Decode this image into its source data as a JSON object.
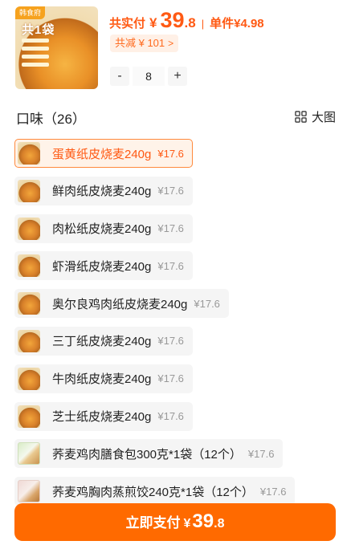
{
  "product": {
    "thumb_badge": "韩食府",
    "thumb_title": "共1袋",
    "total_label": "共实付",
    "currency": "¥",
    "total_int": "39",
    "total_dec": ".8",
    "separator": "|",
    "unit_price": "单件¥4.98",
    "discount": "共减 ¥ 101",
    "discount_chevron": ">",
    "quantity": "8",
    "minus": "-",
    "plus": "+"
  },
  "flavors": {
    "title": "口味（26）",
    "view_toggle_label": "大图",
    "items": [
      {
        "name": "蛋黄纸皮烧麦240g",
        "price": "¥17.6"
      },
      {
        "name": "鲜肉纸皮烧麦240g",
        "price": "¥17.6"
      },
      {
        "name": "肉松纸皮烧麦240g",
        "price": "¥17.6"
      },
      {
        "name": "虾滑纸皮烧麦240g",
        "price": "¥17.6"
      },
      {
        "name": "奥尔良鸡肉纸皮烧麦240g",
        "price": "¥17.6"
      },
      {
        "name": "三丁纸皮烧麦240g",
        "price": "¥17.6"
      },
      {
        "name": "牛肉纸皮烧麦240g",
        "price": "¥17.6"
      },
      {
        "name": "芝士纸皮烧麦240g",
        "price": "¥17.6"
      },
      {
        "name": "荞麦鸡肉膳食包300克*1袋（12个）",
        "price": "¥17.6"
      },
      {
        "name": "荞麦鸡胸肉蒸煎饺240克*1袋（12个）",
        "price": "¥17.6"
      }
    ]
  },
  "pay": {
    "label": "立即支付",
    "currency": "¥",
    "int": "39",
    "dec": ".8"
  },
  "colors": {
    "accent": "#ff6a00",
    "price": "#ff5a14",
    "selected_bg": "#fff3e9"
  }
}
